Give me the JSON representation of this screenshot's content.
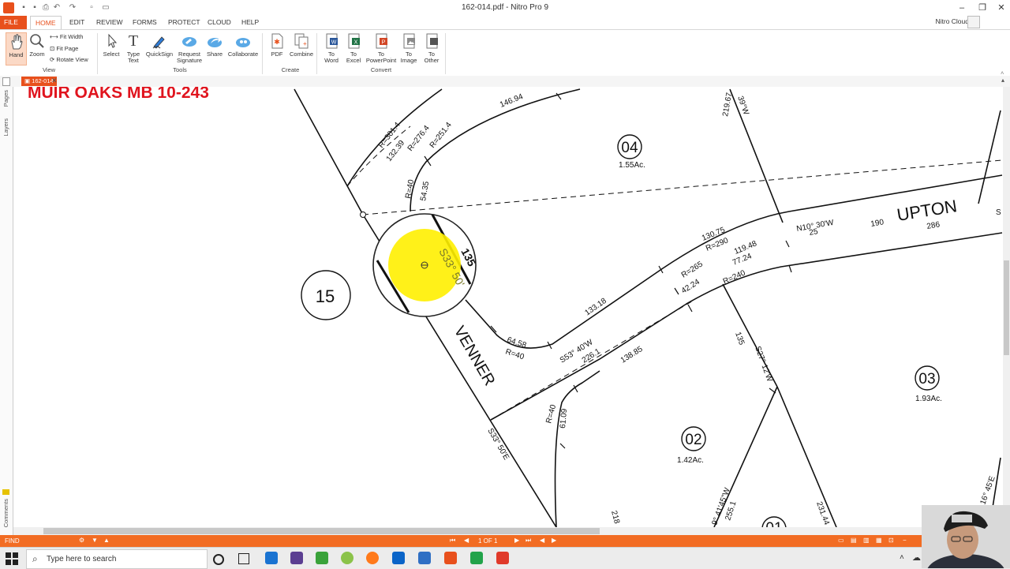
{
  "window": {
    "title": "162-014.pdf - Nitro Pro 9",
    "controls": {
      "minimize": "–",
      "restore": "❐",
      "close": "✕"
    },
    "quick_access_icons": [
      "save-icon",
      "save-icon",
      "print-icon",
      "undo-icon",
      "redo-icon",
      "new-icon",
      "open-icon"
    ]
  },
  "ribbon": {
    "tabs": [
      "FILE",
      "HOME",
      "EDIT",
      "REVIEW",
      "FORMS",
      "PROTECT",
      "CLOUD",
      "HELP"
    ],
    "active_tab": "HOME",
    "account": "Nitro Cloud",
    "view_group": {
      "label": "View",
      "hand": "Hand",
      "zoom": "Zoom",
      "fit_width": "Fit Width",
      "fit_page": "Fit Page",
      "rotate_view": "Rotate View"
    },
    "tools_group": {
      "label": "Tools",
      "select": "Select",
      "type_text_1": "Type",
      "type_text_2": "Text",
      "quicksign": "QuickSign",
      "request_signature_1": "Request",
      "request_signature_2": "Signature",
      "share": "Share",
      "collaborate": "Collaborate"
    },
    "create_group": {
      "label": "Create",
      "pdf": "PDF",
      "combine": "Combine"
    },
    "convert_group": {
      "label": "Convert",
      "to_word_1": "To",
      "to_word_2": "Word",
      "to_excel_1": "To",
      "to_excel_2": "Excel",
      "to_ppt_1": "To",
      "to_ppt_2": "PowerPoint",
      "to_image_1": "To",
      "to_image_2": "Image",
      "to_other_1": "To",
      "to_other_2": "Other"
    }
  },
  "document_tab": "162-014",
  "left_panel": {
    "pages": "Pages",
    "layers": "Layers",
    "comments": "Comments"
  },
  "map": {
    "heading": "MUIR OAKS   MB 10-243",
    "street_upton": "UPTON",
    "street_venner": "VENNER",
    "lots": [
      {
        "num": "04",
        "area": "1.55Ac."
      },
      {
        "num": "15",
        "area": ""
      },
      {
        "num": "03",
        "area": "1.93Ac."
      },
      {
        "num": "02",
        "area": "1.42Ac."
      },
      {
        "num": "01",
        "area": ""
      }
    ],
    "dims": {
      "d146": "146.94",
      "r301": "R=301.4",
      "d132": "132.39",
      "r276": "R=276.4",
      "r251": "R=251.4",
      "r40a": "R=40",
      "d54": "54.35",
      "d219": "219.67",
      "b39": "39°W",
      "d135a": "135",
      "bearing_s33": "S33° 50'",
      "d130": "130.75",
      "r290": "R=290",
      "n10": "N10° 30'W",
      "d25": "25",
      "d190": "190",
      "d286": "286",
      "d119": "119.48",
      "d77": "77.24",
      "r265": "R=265",
      "d42": "42.24",
      "r240": "R=240",
      "d133": "133.18",
      "d64": "64.58",
      "r40b": "R=40",
      "s53": "S53° 40'W",
      "d226": "226.1",
      "d138": "138.85",
      "d135b": "135",
      "s27": "S27° 12'W",
      "r40c": "R=40",
      "d61": "61.09",
      "s33e": "S33° 50'E",
      "d218": "218",
      "b4145": "9° 41'45\"W",
      "d255": "255.1",
      "d231": "231.44",
      "b16": "16° 45'E",
      "edge_s": "S"
    }
  },
  "status": {
    "find": "FIND",
    "page_info": "1 OF 1"
  },
  "taskbar": {
    "search_placeholder": "Type here to search"
  },
  "colors": {
    "accent": "#e8501c",
    "statusbar": "#f26c23",
    "heading_red": "#e0141e",
    "highlight": "#ffef00"
  }
}
